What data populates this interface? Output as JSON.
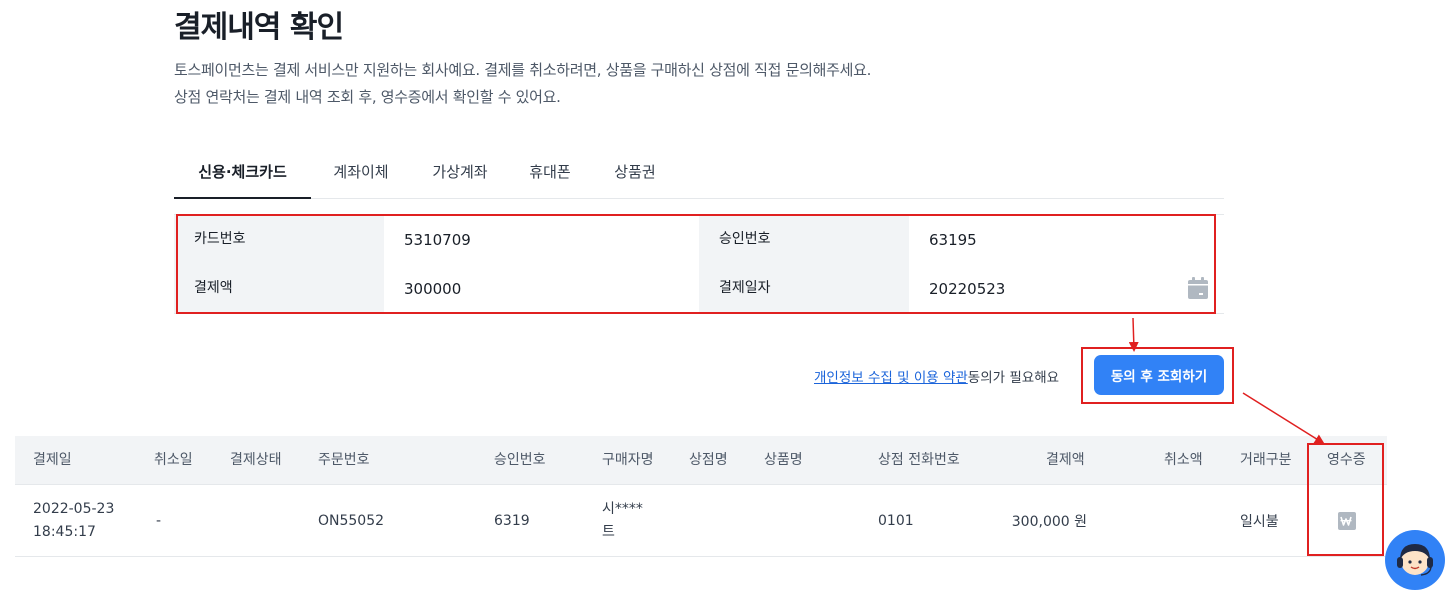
{
  "page": {
    "title": "결제내역 확인",
    "description_1": "토스페이먼츠는 결제 서비스만 지원하는 회사예요. 결제를 취소하려면, 상품을 구매하신 상점에 직접 문의해주세요.",
    "description_2": "상점 연락처는 결제 내역 조회 후, 영수증에서 확인할 수 있어요."
  },
  "tabs": [
    {
      "label": "신용·체크카드",
      "active": true
    },
    {
      "label": "계좌이체",
      "active": false
    },
    {
      "label": "가상계좌",
      "active": false
    },
    {
      "label": "휴대폰",
      "active": false
    },
    {
      "label": "상품권",
      "active": false
    }
  ],
  "form": {
    "card_number_label": "카드번호",
    "card_number_value": "5310709",
    "approval_number_label": "승인번호",
    "approval_number_value": "63195",
    "amount_label": "결제액",
    "amount_value": "300000",
    "date_label": "결제일자",
    "date_value": "20220523",
    "calendar_icon": "calendar-icon"
  },
  "agree": {
    "link_text": "개인정보 수집 및 이용 약관",
    "suffix": "동의가 필요해요",
    "button_label": "동의 후 조회하기"
  },
  "results": {
    "columns": [
      "결제일",
      "취소일",
      "결제상태",
      "주문번호",
      "승인번호",
      "구매자명",
      "상점명",
      "상품명",
      "상점 전화번호",
      "결제액",
      "취소액",
      "거래구분",
      "영수증"
    ],
    "rows": [
      {
        "date": "2022-05-23",
        "time": "18:45:17",
        "cancel_date": "-",
        "status": "",
        "order_no": "ON55052",
        "approval_no": "6319",
        "buyer_1": "시****",
        "buyer_2": "트",
        "store": "",
        "product": "",
        "phone": "0101",
        "amount": "300,000 원",
        "cancel_amount": "",
        "type": "일시불",
        "receipt_icon": "won-receipt-icon"
      }
    ]
  },
  "annotation_color": "#e02020",
  "accent_color": "#3182f6"
}
